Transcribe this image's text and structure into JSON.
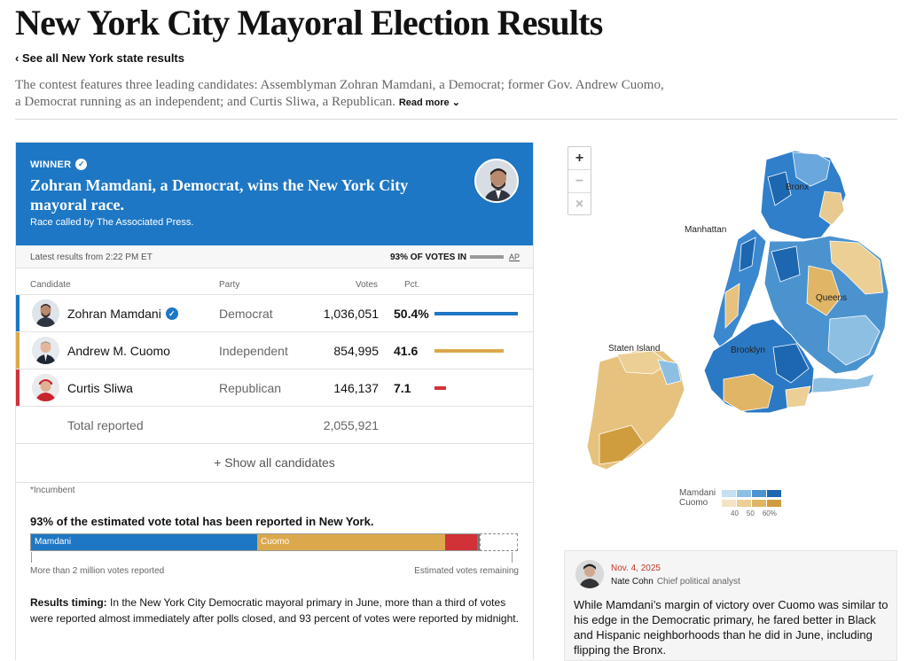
{
  "header": {
    "title": "New York City Mayoral Election Results",
    "back_link": "‹ See all New York state results",
    "intro": "The contest features three leading candidates: Assemblyman Zohran Mamdani, a Democrat; former Gov. Andrew Cuomo, a Democrat running as an independent; and Curtis Sliwa, a Republican.",
    "read_more": "Read more ⌄"
  },
  "winner": {
    "tag": "WINNER",
    "headline": "Zohran Mamdani, a Democrat, wins the New York City mayoral race.",
    "called_by": "Race called by The Associated Press."
  },
  "status": {
    "latest": "Latest results from 2:22 PM ET",
    "pct_in": "93% OF VOTES IN",
    "ap": "AP"
  },
  "table": {
    "columns": {
      "candidate": "Candidate",
      "party": "Party",
      "votes": "Votes",
      "pct": "Pct."
    },
    "rows": [
      {
        "name": "Zohran Mamdani",
        "party": "Democrat",
        "votes": "1,036,051",
        "pct": "50.4%",
        "share": 50.4,
        "color": "#1d77c4",
        "verified": true
      },
      {
        "name": "Andrew M. Cuomo",
        "party": "Independent",
        "votes": "854,995",
        "pct": "41.6",
        "share": 41.6,
        "color": "#dba94c",
        "verified": false
      },
      {
        "name": "Curtis Sliwa",
        "party": "Republican",
        "votes": "146,137",
        "pct": "7.1",
        "share": 7.1,
        "color": "#d03238",
        "verified": false
      }
    ],
    "total_label": "Total reported",
    "total_votes": "2,055,921",
    "show_all": "+ Show all candidates",
    "incumbent_note": "*Incumbent"
  },
  "reporting": {
    "headline": "93% of the estimated vote total has been reported in New York.",
    "bar_mamdani": "Mamdani",
    "bar_cuomo": "Cuomo",
    "segments": [
      {
        "share": 0.466,
        "color": "#1d77c4"
      },
      {
        "share": 0.387,
        "color": "#dba94c"
      },
      {
        "share": 0.065,
        "color": "#d03238"
      },
      {
        "share": 0.006,
        "color": "#777777"
      }
    ],
    "remaining_share": 0.076,
    "left_label": "More than 2 million votes reported",
    "right_label": "Estimated votes remaining",
    "timing_label": "Results timing:",
    "timing_text": " In the New York City Democratic mayoral primary in June, more than a third of votes were reported almost immediately after polls closed, and 93 percent of votes were reported by midnight."
  },
  "map": {
    "zoom_in": "+",
    "zoom_out": "−",
    "reset": "×",
    "labels": {
      "bronx": "Bronx",
      "manhattan": "Manhattan",
      "queens": "Queens",
      "brooklyn": "Brooklyn",
      "staten_island": "Staten Island"
    }
  },
  "legend": {
    "mamdani": "Mamdani",
    "cuomo": "Cuomo",
    "ticks": [
      "40",
      "50",
      "60%"
    ],
    "mamdani_colors": [
      "#c5e0f2",
      "#8dbfe3",
      "#4b93cf",
      "#1d66b0"
    ],
    "cuomo_colors": [
      "#f4e4c4",
      "#ebcf94",
      "#e0b565",
      "#d09d3e"
    ]
  },
  "analyst": {
    "date": "Nov. 4, 2025",
    "name": "Nate Cohn",
    "role": "Chief political analyst",
    "body": "While Mamdani’s margin of victory over Cuomo was similar to his edge in the Democratic primary, he fared better in Black and Hispanic neighborhoods than he did in June, including flipping the Bronx."
  }
}
